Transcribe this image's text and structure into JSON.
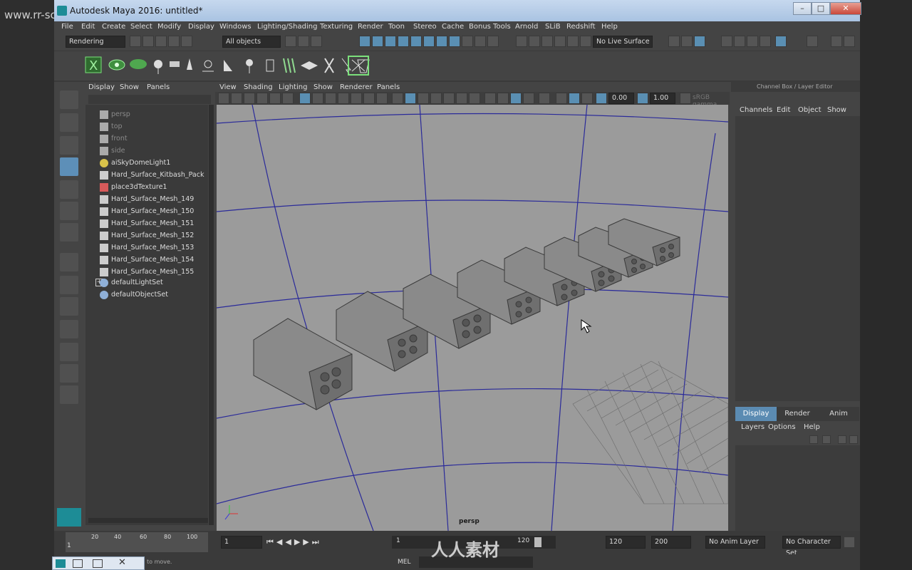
{
  "watermark": {
    "top_left": "www.rr-sc.com",
    "center": "人人素材",
    "colors": {
      "accent": "#5b8bb2",
      "viewport_bg": "#9b9b9b",
      "grid_line": "#2a2a9a"
    }
  },
  "window": {
    "title": "Autodesk Maya 2016: untitled*",
    "minimize": "–",
    "maximize": "□",
    "close": "✕"
  },
  "menubar": [
    "File",
    "Edit",
    "Create",
    "Select",
    "Modify",
    "Display",
    "Windows",
    "Lighting/Shading",
    "Texturing",
    "Render",
    "Toon",
    "Stereo",
    "Cache",
    "Bonus Tools",
    "Arnold",
    "SLiB",
    "Redshift",
    "Help"
  ],
  "statusline": {
    "menuset": "Rendering",
    "selection_mask": "All objects",
    "live_surface": "No Live Surface"
  },
  "outliner": {
    "menus": [
      "Display",
      "Show",
      "Panels"
    ],
    "items": [
      {
        "label": "persp",
        "icon": "camera-icon",
        "dim": true
      },
      {
        "label": "top",
        "icon": "camera-icon",
        "dim": true
      },
      {
        "label": "front",
        "icon": "camera-icon",
        "dim": true
      },
      {
        "label": "side",
        "icon": "camera-icon",
        "dim": true
      },
      {
        "label": "aiSkyDomeLight1",
        "icon": "light-icon",
        "dim": false
      },
      {
        "label": "Hard_Surface_Kitbash_Pack",
        "icon": "mesh-icon",
        "dim": false
      },
      {
        "label": "place3dTexture1",
        "icon": "texture-icon",
        "dim": false
      },
      {
        "label": "Hard_Surface_Mesh_149",
        "icon": "mesh-icon",
        "dim": false
      },
      {
        "label": "Hard_Surface_Mesh_150",
        "icon": "mesh-icon",
        "dim": false
      },
      {
        "label": "Hard_Surface_Mesh_151",
        "icon": "mesh-icon",
        "dim": false
      },
      {
        "label": "Hard_Surface_Mesh_152",
        "icon": "mesh-icon",
        "dim": false
      },
      {
        "label": "Hard_Surface_Mesh_153",
        "icon": "mesh-icon",
        "dim": false
      },
      {
        "label": "Hard_Surface_Mesh_154",
        "icon": "mesh-icon",
        "dim": false
      },
      {
        "label": "Hard_Surface_Mesh_155",
        "icon": "mesh-icon",
        "dim": false
      },
      {
        "label": "defaultLightSet",
        "icon": "set-icon",
        "dim": false
      },
      {
        "label": "defaultObjectSet",
        "icon": "set-icon",
        "dim": false
      }
    ]
  },
  "viewport": {
    "menus": [
      "View",
      "Shading",
      "Lighting",
      "Show",
      "Renderer",
      "Panels"
    ],
    "exposure": "0.00",
    "gamma": "1.00",
    "color_space": "sRGB gamma",
    "camera_label": "persp"
  },
  "channelbox": {
    "header": "Channel Box / Layer Editor",
    "menus": [
      "Channels",
      "Edit",
      "Object",
      "Show"
    ],
    "tabs": [
      "Display",
      "Render",
      "Anim"
    ],
    "layer_menus": [
      "Layers",
      "Options",
      "Help"
    ]
  },
  "timeline": {
    "ticks": [
      "20",
      "40",
      "60",
      "80",
      "100"
    ],
    "start_frame": "1",
    "current_frame": "1",
    "range_start": "1",
    "range_end_field": "120",
    "anim_end": "120",
    "total_end": "200",
    "anim_layer": "No Anim Layer",
    "character_set": "No Character Set"
  },
  "commandline": {
    "language": "MEL",
    "help_text": "to move."
  }
}
